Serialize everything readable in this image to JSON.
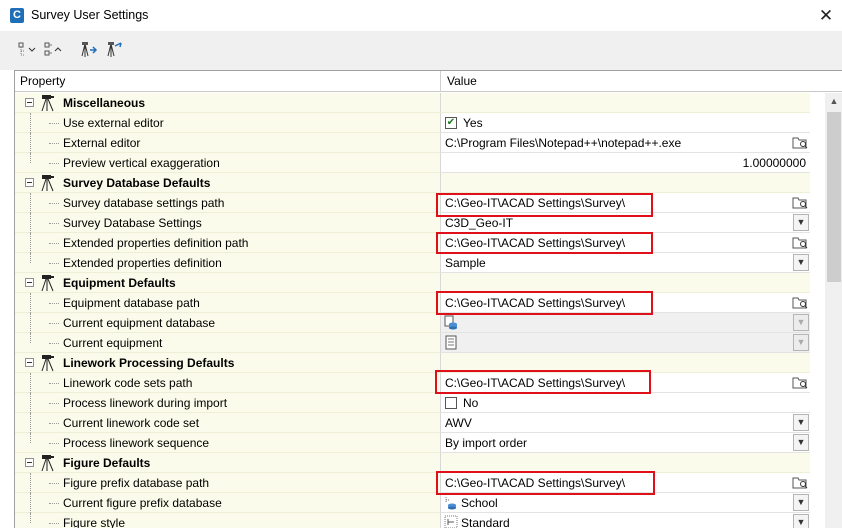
{
  "window": {
    "title": "Survey User Settings",
    "app_icon_letter": "C"
  },
  "grid": {
    "col_property": "Property",
    "col_value": "Value"
  },
  "categories": [
    {
      "label": "Miscellaneous"
    },
    {
      "label": "Survey Database Defaults"
    },
    {
      "label": "Equipment Defaults"
    },
    {
      "label": "Linework Processing Defaults"
    },
    {
      "label": "Figure Defaults"
    }
  ],
  "properties": {
    "use_external_editor": {
      "label": "Use external editor",
      "value": "Yes",
      "checked": true
    },
    "external_editor": {
      "label": "External editor",
      "value": "C:\\Program Files\\Notepad++\\notepad++.exe"
    },
    "preview_vertical_exaggeration": {
      "label": "Preview vertical exaggeration",
      "value": "1.00000000"
    },
    "survey_db_settings_path": {
      "label": "Survey database settings path",
      "value": "C:\\Geo-IT\\ACAD Settings\\Survey\\"
    },
    "survey_db_settings": {
      "label": "Survey Database Settings",
      "value": "C3D_Geo-IT"
    },
    "ext_props_def_path": {
      "label": "Extended properties definition path",
      "value": "C:\\Geo-IT\\ACAD Settings\\Survey\\"
    },
    "ext_props_def": {
      "label": "Extended properties definition",
      "value": "Sample"
    },
    "equipment_db_path": {
      "label": "Equipment database path",
      "value": "C:\\Geo-IT\\ACAD Settings\\Survey\\"
    },
    "current_equipment_db": {
      "label": "Current equipment database",
      "value": ""
    },
    "current_equipment": {
      "label": "Current equipment",
      "value": ""
    },
    "linework_code_sets_path": {
      "label": "Linework code sets path",
      "value": "C:\\Geo-IT\\ACAD Settings\\Survey\\"
    },
    "process_linework_import": {
      "label": "Process linework during import",
      "value": "No",
      "checked": false
    },
    "current_linework_code_set": {
      "label": "Current linework code set",
      "value": "AWV"
    },
    "process_linework_sequence": {
      "label": "Process linework sequence",
      "value": "By import order"
    },
    "figure_prefix_db_path": {
      "label": "Figure prefix database path",
      "value": "C:\\Geo-IT\\ACAD Settings\\Survey\\"
    },
    "current_figure_prefix_db": {
      "label": "Current figure prefix database",
      "value": "School"
    },
    "figure_style": {
      "label": "Figure style",
      "value": "Standard"
    }
  },
  "colors": {
    "highlight": "#e0101a",
    "property_bg": "#fbfbeb"
  }
}
